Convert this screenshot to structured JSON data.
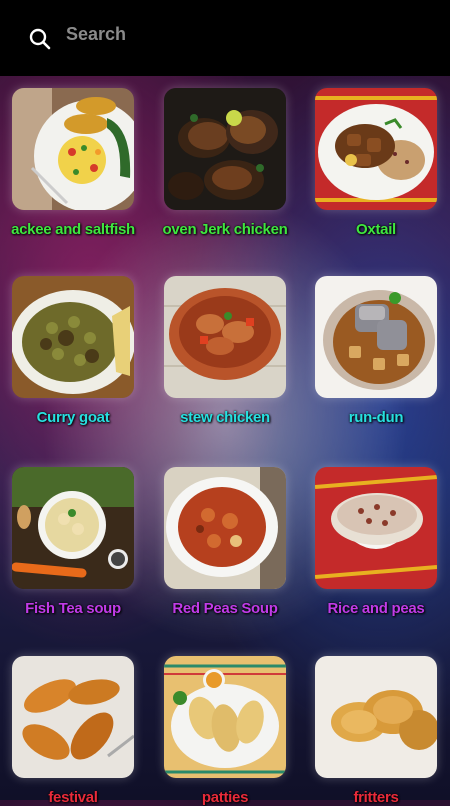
{
  "search": {
    "placeholder": "Search"
  },
  "items": [
    {
      "name": "ackee and saltfish",
      "color": "#3fe63f"
    },
    {
      "name": "oven Jerk chicken",
      "color": "#3fe63f"
    },
    {
      "name": "Oxtail",
      "color": "#3fe63f"
    },
    {
      "name": "Curry goat",
      "color": "#27e0e0"
    },
    {
      "name": "stew chicken",
      "color": "#27e0e0"
    },
    {
      "name": "run-dun",
      "color": "#27e0e0"
    },
    {
      "name": "Fish Tea soup",
      "color": "#c13be8"
    },
    {
      "name": "Red Peas Soup",
      "color": "#c13be8"
    },
    {
      "name": "Rice and peas",
      "color": "#c13be8"
    },
    {
      "name": "festival",
      "color": "#e82a3a"
    },
    {
      "name": "patties",
      "color": "#e82a3a"
    },
    {
      "name": "fritters",
      "color": "#e82a3a"
    }
  ]
}
